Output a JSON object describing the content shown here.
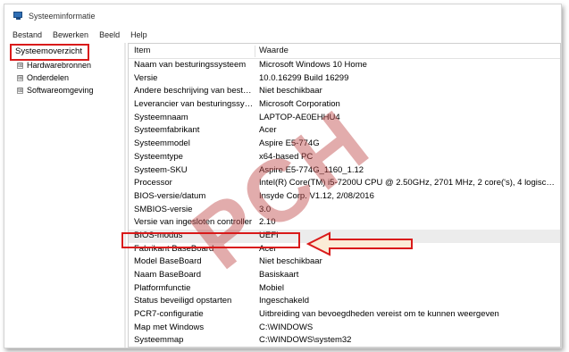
{
  "window": {
    "title": "Systeeminformatie"
  },
  "menu": [
    "Bestand",
    "Bewerken",
    "Beeld",
    "Help"
  ],
  "tree": {
    "root": "Systeemoverzicht",
    "children": [
      "Hardwarebronnen",
      "Onderdelen",
      "Softwareomgeving"
    ],
    "expander_symbol": "⊞"
  },
  "table": {
    "columns": [
      "Item",
      "Waarde"
    ],
    "rows": [
      {
        "item": "Naam van besturingssysteem",
        "value": "Microsoft Windows 10 Home"
      },
      {
        "item": "Versie",
        "value": "10.0.16299 Build 16299"
      },
      {
        "item": "Andere beschrijving van besturi...",
        "value": "Niet beschikbaar"
      },
      {
        "item": "Leverancier van besturingssyst...",
        "value": "Microsoft Corporation"
      },
      {
        "item": "Systeemnaam",
        "value": "LAPTOP-AE0EHHU4"
      },
      {
        "item": "Systeemfabrikant",
        "value": "Acer"
      },
      {
        "item": "Systeemmodel",
        "value": "Aspire E5-774G"
      },
      {
        "item": "Systeemtype",
        "value": "x64-based PC"
      },
      {
        "item": "Systeem-SKU",
        "value": "Aspire E5-774G_1160_1.12"
      },
      {
        "item": "Processor",
        "value": "Intel(R) Core(TM) i5-7200U CPU @ 2.50GHz, 2701 MHz, 2 core('s), 4 logische ..."
      },
      {
        "item": "BIOS-versie/datum",
        "value": "Insyde Corp. V1.12, 2/08/2016"
      },
      {
        "item": "SMBIOS-versie",
        "value": "3.0"
      },
      {
        "item": "Versie van ingesloten controller",
        "value": "2.10"
      },
      {
        "item": "BIOS-modus",
        "value": "UEFI"
      },
      {
        "item": "Fabrikant BaseBoard",
        "value": "Acer"
      },
      {
        "item": "Model BaseBoard",
        "value": "Niet beschikbaar"
      },
      {
        "item": "Naam BaseBoard",
        "value": "Basiskaart"
      },
      {
        "item": "Platformfunctie",
        "value": "Mobiel"
      },
      {
        "item": "Status beveiligd opstarten",
        "value": "Ingeschakeld"
      },
      {
        "item": "PCR7-configuratie",
        "value": "Uitbreiding van bevoegdheden vereist om te kunnen weergeven"
      },
      {
        "item": "Map met Windows",
        "value": "C:\\WINDOWS"
      },
      {
        "item": "Systeemmap",
        "value": "C:\\WINDOWS\\system32"
      }
    ]
  },
  "watermark": "PCH",
  "colors": {
    "highlight": "#d91a1a",
    "watermark": "#be4646"
  }
}
